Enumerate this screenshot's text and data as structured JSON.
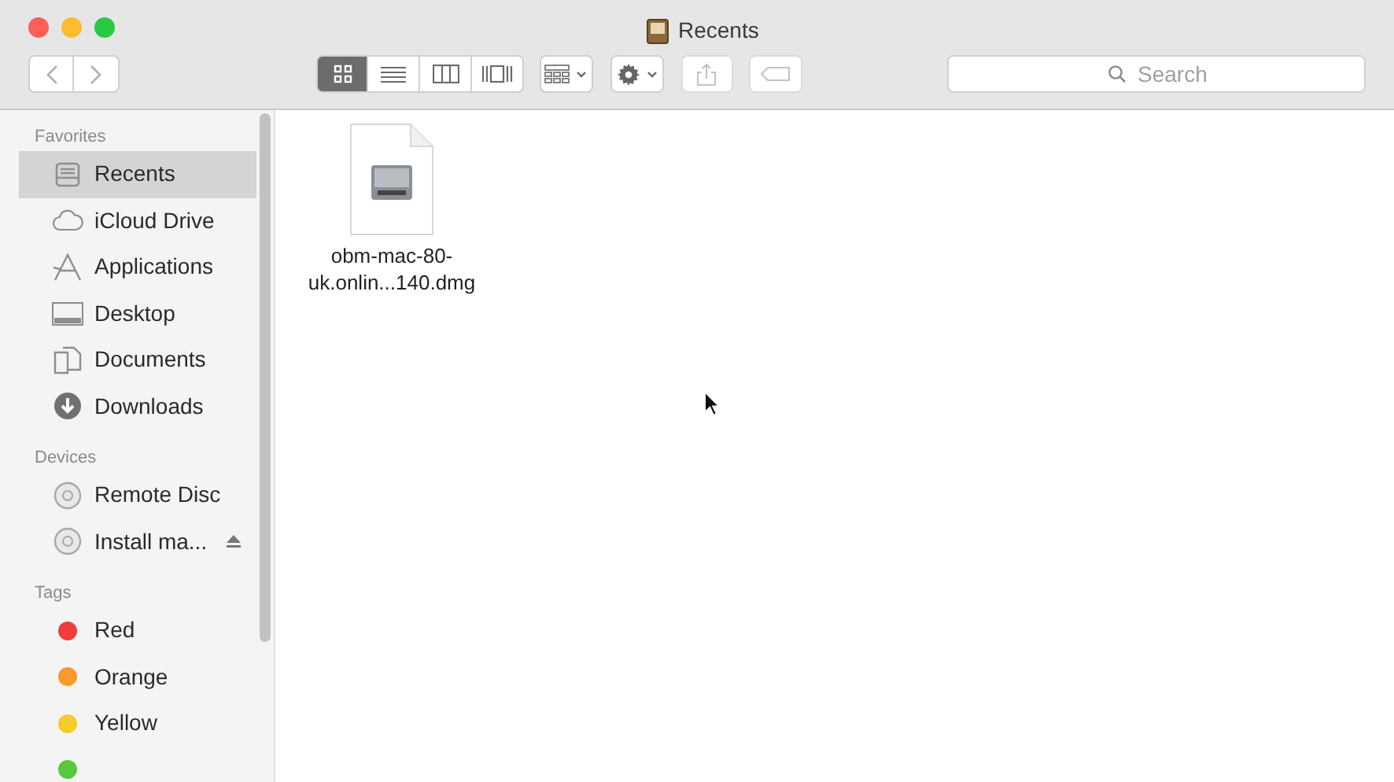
{
  "window": {
    "title": "Recents"
  },
  "toolbar": {
    "view_modes": [
      {
        "kind": "icons",
        "selected": true
      },
      {
        "kind": "list",
        "selected": false
      },
      {
        "kind": "columns",
        "selected": false
      },
      {
        "kind": "cover",
        "selected": false
      }
    ],
    "search": {
      "placeholder": "Search"
    }
  },
  "sidebar": {
    "sections": [
      {
        "title": "Favorites",
        "items": [
          {
            "label": "Recents",
            "kind": "recents",
            "selected": true
          },
          {
            "label": "iCloud Drive",
            "kind": "cloud",
            "selected": false
          },
          {
            "label": "Applications",
            "kind": "apps",
            "selected": false
          },
          {
            "label": "Desktop",
            "kind": "desktop",
            "selected": false
          },
          {
            "label": "Documents",
            "kind": "documents",
            "selected": false
          },
          {
            "label": "Downloads",
            "kind": "downloads",
            "selected": false
          }
        ]
      },
      {
        "title": "Devices",
        "items": [
          {
            "label": "Remote Disc",
            "kind": "disc",
            "selected": false,
            "ejectable": false
          },
          {
            "label": "Install ma...",
            "kind": "disc",
            "selected": false,
            "ejectable": true
          }
        ]
      },
      {
        "title": "Tags",
        "items": [
          {
            "label": "Red",
            "kind": "tag",
            "color": "#f03c3c",
            "selected": false
          },
          {
            "label": "Orange",
            "kind": "tag",
            "color": "#f79a2a",
            "selected": false
          },
          {
            "label": "Yellow",
            "kind": "tag",
            "color": "#f5cc2a",
            "selected": false
          },
          {
            "kind": "tag",
            "color": "#5ac83c",
            "selected": false
          }
        ]
      }
    ]
  },
  "files": [
    {
      "name": "obm-mac-80-\nuk.onlin...140.dmg",
      "kind": "disk-image"
    }
  ]
}
